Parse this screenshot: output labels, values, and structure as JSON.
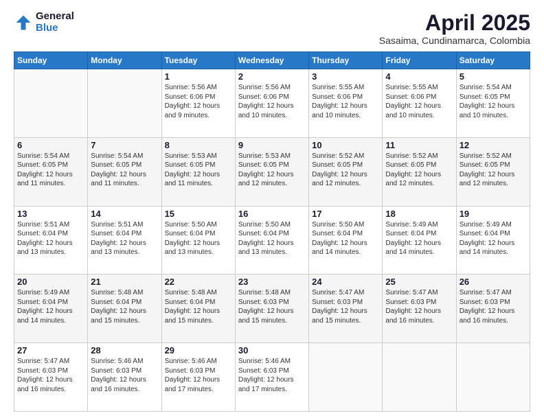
{
  "logo": {
    "general": "General",
    "blue": "Blue"
  },
  "header": {
    "month": "April 2025",
    "location": "Sasaima, Cundinamarca, Colombia"
  },
  "weekdays": [
    "Sunday",
    "Monday",
    "Tuesday",
    "Wednesday",
    "Thursday",
    "Friday",
    "Saturday"
  ],
  "weeks": [
    {
      "shade": false,
      "days": [
        {
          "num": "",
          "empty": true,
          "lines": []
        },
        {
          "num": "",
          "empty": true,
          "lines": []
        },
        {
          "num": "1",
          "empty": false,
          "lines": [
            "Sunrise: 5:56 AM",
            "Sunset: 6:06 PM",
            "Daylight: 12 hours",
            "and 9 minutes."
          ]
        },
        {
          "num": "2",
          "empty": false,
          "lines": [
            "Sunrise: 5:56 AM",
            "Sunset: 6:06 PM",
            "Daylight: 12 hours",
            "and 10 minutes."
          ]
        },
        {
          "num": "3",
          "empty": false,
          "lines": [
            "Sunrise: 5:55 AM",
            "Sunset: 6:06 PM",
            "Daylight: 12 hours",
            "and 10 minutes."
          ]
        },
        {
          "num": "4",
          "empty": false,
          "lines": [
            "Sunrise: 5:55 AM",
            "Sunset: 6:06 PM",
            "Daylight: 12 hours",
            "and 10 minutes."
          ]
        },
        {
          "num": "5",
          "empty": false,
          "lines": [
            "Sunrise: 5:54 AM",
            "Sunset: 6:05 PM",
            "Daylight: 12 hours",
            "and 10 minutes."
          ]
        }
      ]
    },
    {
      "shade": true,
      "days": [
        {
          "num": "6",
          "empty": false,
          "lines": [
            "Sunrise: 5:54 AM",
            "Sunset: 6:05 PM",
            "Daylight: 12 hours",
            "and 11 minutes."
          ]
        },
        {
          "num": "7",
          "empty": false,
          "lines": [
            "Sunrise: 5:54 AM",
            "Sunset: 6:05 PM",
            "Daylight: 12 hours",
            "and 11 minutes."
          ]
        },
        {
          "num": "8",
          "empty": false,
          "lines": [
            "Sunrise: 5:53 AM",
            "Sunset: 6:05 PM",
            "Daylight: 12 hours",
            "and 11 minutes."
          ]
        },
        {
          "num": "9",
          "empty": false,
          "lines": [
            "Sunrise: 5:53 AM",
            "Sunset: 6:05 PM",
            "Daylight: 12 hours",
            "and 12 minutes."
          ]
        },
        {
          "num": "10",
          "empty": false,
          "lines": [
            "Sunrise: 5:52 AM",
            "Sunset: 6:05 PM",
            "Daylight: 12 hours",
            "and 12 minutes."
          ]
        },
        {
          "num": "11",
          "empty": false,
          "lines": [
            "Sunrise: 5:52 AM",
            "Sunset: 6:05 PM",
            "Daylight: 12 hours",
            "and 12 minutes."
          ]
        },
        {
          "num": "12",
          "empty": false,
          "lines": [
            "Sunrise: 5:52 AM",
            "Sunset: 6:05 PM",
            "Daylight: 12 hours",
            "and 12 minutes."
          ]
        }
      ]
    },
    {
      "shade": false,
      "days": [
        {
          "num": "13",
          "empty": false,
          "lines": [
            "Sunrise: 5:51 AM",
            "Sunset: 6:04 PM",
            "Daylight: 12 hours",
            "and 13 minutes."
          ]
        },
        {
          "num": "14",
          "empty": false,
          "lines": [
            "Sunrise: 5:51 AM",
            "Sunset: 6:04 PM",
            "Daylight: 12 hours",
            "and 13 minutes."
          ]
        },
        {
          "num": "15",
          "empty": false,
          "lines": [
            "Sunrise: 5:50 AM",
            "Sunset: 6:04 PM",
            "Daylight: 12 hours",
            "and 13 minutes."
          ]
        },
        {
          "num": "16",
          "empty": false,
          "lines": [
            "Sunrise: 5:50 AM",
            "Sunset: 6:04 PM",
            "Daylight: 12 hours",
            "and 13 minutes."
          ]
        },
        {
          "num": "17",
          "empty": false,
          "lines": [
            "Sunrise: 5:50 AM",
            "Sunset: 6:04 PM",
            "Daylight: 12 hours",
            "and 14 minutes."
          ]
        },
        {
          "num": "18",
          "empty": false,
          "lines": [
            "Sunrise: 5:49 AM",
            "Sunset: 6:04 PM",
            "Daylight: 12 hours",
            "and 14 minutes."
          ]
        },
        {
          "num": "19",
          "empty": false,
          "lines": [
            "Sunrise: 5:49 AM",
            "Sunset: 6:04 PM",
            "Daylight: 12 hours",
            "and 14 minutes."
          ]
        }
      ]
    },
    {
      "shade": true,
      "days": [
        {
          "num": "20",
          "empty": false,
          "lines": [
            "Sunrise: 5:49 AM",
            "Sunset: 6:04 PM",
            "Daylight: 12 hours",
            "and 14 minutes."
          ]
        },
        {
          "num": "21",
          "empty": false,
          "lines": [
            "Sunrise: 5:48 AM",
            "Sunset: 6:04 PM",
            "Daylight: 12 hours",
            "and 15 minutes."
          ]
        },
        {
          "num": "22",
          "empty": false,
          "lines": [
            "Sunrise: 5:48 AM",
            "Sunset: 6:04 PM",
            "Daylight: 12 hours",
            "and 15 minutes."
          ]
        },
        {
          "num": "23",
          "empty": false,
          "lines": [
            "Sunrise: 5:48 AM",
            "Sunset: 6:03 PM",
            "Daylight: 12 hours",
            "and 15 minutes."
          ]
        },
        {
          "num": "24",
          "empty": false,
          "lines": [
            "Sunrise: 5:47 AM",
            "Sunset: 6:03 PM",
            "Daylight: 12 hours",
            "and 15 minutes."
          ]
        },
        {
          "num": "25",
          "empty": false,
          "lines": [
            "Sunrise: 5:47 AM",
            "Sunset: 6:03 PM",
            "Daylight: 12 hours",
            "and 16 minutes."
          ]
        },
        {
          "num": "26",
          "empty": false,
          "lines": [
            "Sunrise: 5:47 AM",
            "Sunset: 6:03 PM",
            "Daylight: 12 hours",
            "and 16 minutes."
          ]
        }
      ]
    },
    {
      "shade": false,
      "days": [
        {
          "num": "27",
          "empty": false,
          "lines": [
            "Sunrise: 5:47 AM",
            "Sunset: 6:03 PM",
            "Daylight: 12 hours",
            "and 16 minutes."
          ]
        },
        {
          "num": "28",
          "empty": false,
          "lines": [
            "Sunrise: 5:46 AM",
            "Sunset: 6:03 PM",
            "Daylight: 12 hours",
            "and 16 minutes."
          ]
        },
        {
          "num": "29",
          "empty": false,
          "lines": [
            "Sunrise: 5:46 AM",
            "Sunset: 6:03 PM",
            "Daylight: 12 hours",
            "and 17 minutes."
          ]
        },
        {
          "num": "30",
          "empty": false,
          "lines": [
            "Sunrise: 5:46 AM",
            "Sunset: 6:03 PM",
            "Daylight: 12 hours",
            "and 17 minutes."
          ]
        },
        {
          "num": "",
          "empty": true,
          "lines": []
        },
        {
          "num": "",
          "empty": true,
          "lines": []
        },
        {
          "num": "",
          "empty": true,
          "lines": []
        }
      ]
    }
  ]
}
